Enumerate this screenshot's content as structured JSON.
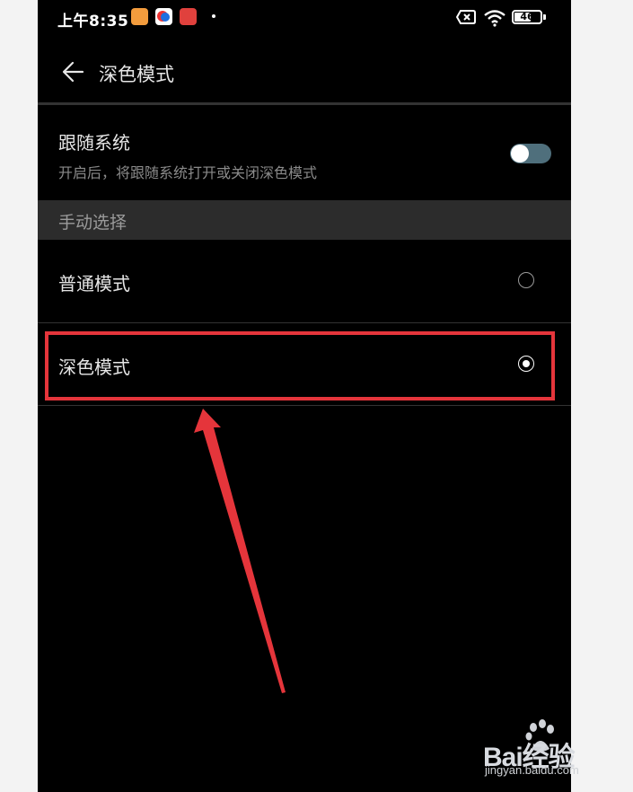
{
  "status_bar": {
    "time": "上午8:35",
    "battery": "46",
    "icons": [
      "app-orange-icon",
      "app-blue-icon",
      "app-red-icon",
      "no-sim-icon",
      "wifi-icon",
      "battery-icon"
    ]
  },
  "header": {
    "title": "深色模式",
    "back_icon": "back-arrow-icon"
  },
  "follow_system": {
    "title": "跟随系统",
    "subtitle": "开启后，将跟随系统打开或关闭深色模式",
    "toggle_on": false
  },
  "manual": {
    "section_label": "手动选择",
    "options": [
      {
        "label": "普通模式",
        "selected": false
      },
      {
        "label": "深色模式",
        "selected": true
      }
    ]
  },
  "colors": {
    "background": "#000000",
    "highlight": "#e5353b",
    "toggle": "#4f6f7c"
  },
  "watermark": {
    "logo_text": "Bai经验",
    "url": "jingyan.baidu.com"
  }
}
